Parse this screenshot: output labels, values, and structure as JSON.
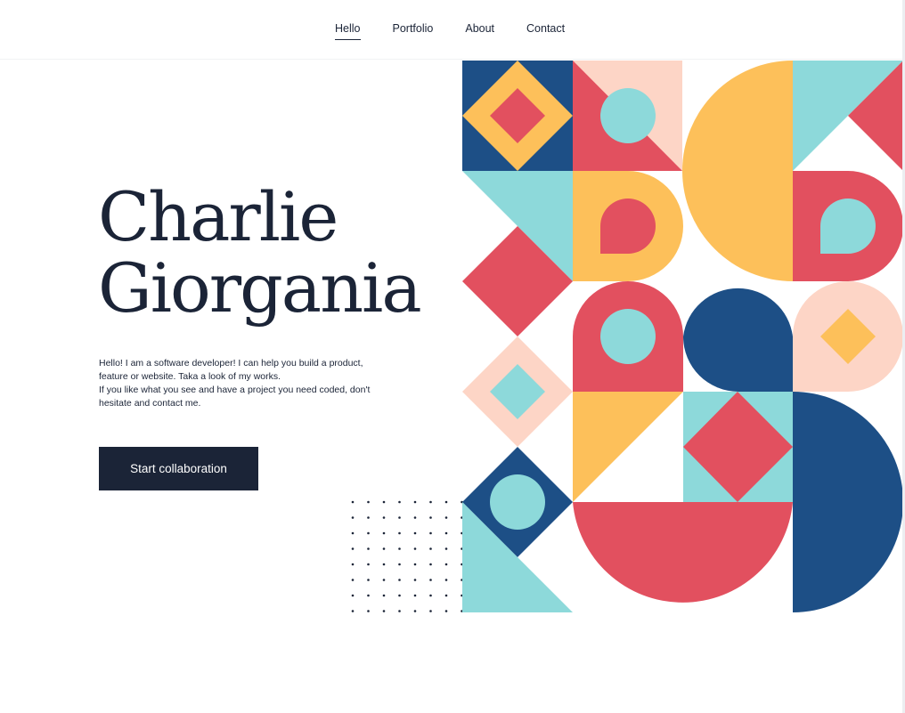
{
  "nav": {
    "items": [
      {
        "label": "Hello",
        "active": true
      },
      {
        "label": "Portfolio",
        "active": false
      },
      {
        "label": "About",
        "active": false
      },
      {
        "label": "Contact",
        "active": false
      }
    ]
  },
  "hero": {
    "name_line1": "Charlie",
    "name_line2": "Giorgania",
    "intro_line1": "Hello! I am a software developer! I can help you build a product,",
    "intro_line2": "feature or website. Taka a look of my works.",
    "intro_line3": "If you like what you see and have a project you need coded, don't",
    "intro_line4": "hesitate and contact me.",
    "cta_label": "Start collaboration"
  },
  "art": {
    "colors": {
      "navy": "#1d4f86",
      "yellow": "#fdc05a",
      "red": "#e2505f",
      "teal": "#8dd9da",
      "peach": "#fdd5c6",
      "ink": "#1b2437"
    }
  }
}
